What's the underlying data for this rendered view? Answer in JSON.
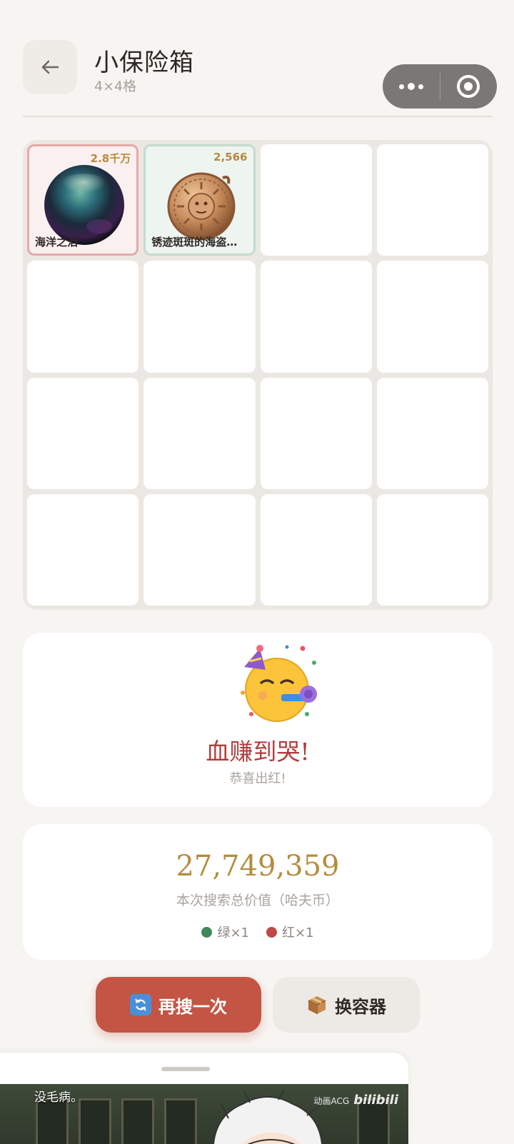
{
  "header": {
    "title": "小保险箱",
    "subtitle": "4×4格"
  },
  "grid": {
    "items": [
      {
        "name": "海洋之泪",
        "price": "2.8千万",
        "rarity": "red",
        "icon": "dark-pearl-icon"
      },
      {
        "name": "锈迹斑斑的海盗…",
        "price": "2,566",
        "rarity": "green",
        "icon": "pirate-coin-icon"
      }
    ]
  },
  "result": {
    "emoji": "party-face-emoji",
    "title": "血赚到哭!",
    "subtitle": "恭喜出红!"
  },
  "total": {
    "value": "27,749,359",
    "label": "本次搜索总价值（哈夫币）",
    "green_count": "绿×1",
    "red_count": "红×1"
  },
  "buttons": {
    "search_again": "再搜一次",
    "change_container": "换容器"
  },
  "video": {
    "caption": "没毛病。",
    "watermark": "动画ACG",
    "logo": "bilibili"
  },
  "colors": {
    "accent": "#c45544",
    "gold": "#b58b3d",
    "green": "#3e8a57",
    "red": "#c24747"
  }
}
